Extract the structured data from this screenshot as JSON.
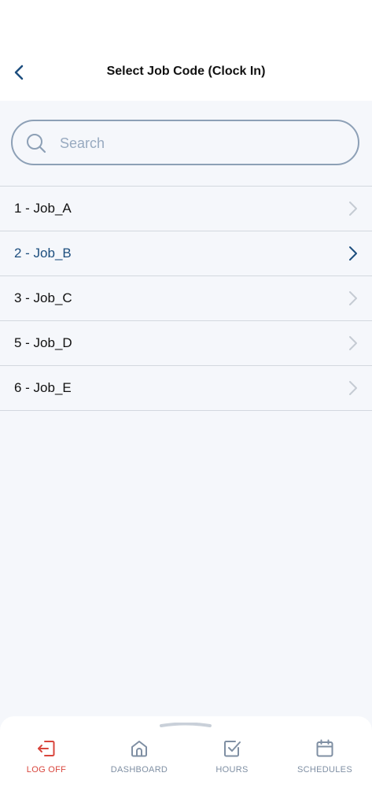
{
  "header": {
    "title": "Select Job Code (Clock In)",
    "back_icon": "chevron-left-icon"
  },
  "search": {
    "placeholder": "Search",
    "value": ""
  },
  "job_codes": [
    {
      "label": "1 - Job_A",
      "selected": false
    },
    {
      "label": "2 - Job_B",
      "selected": true
    },
    {
      "label": "3 - Job_C",
      "selected": false
    },
    {
      "label": "5 - Job_D",
      "selected": false
    },
    {
      "label": "6 - Job_E",
      "selected": false
    }
  ],
  "bottom_nav": [
    {
      "label": "LOG OFF",
      "icon": "logout-icon"
    },
    {
      "label": "DASHBOARD",
      "icon": "home-icon"
    },
    {
      "label": "HOURS",
      "icon": "checkbox-icon"
    },
    {
      "label": "SCHEDULES",
      "icon": "calendar-icon"
    }
  ],
  "colors": {
    "accent": "#1d4e7e",
    "logoff": "#d9463d",
    "muted": "#7f8fa3",
    "background": "#f5f7fb"
  }
}
